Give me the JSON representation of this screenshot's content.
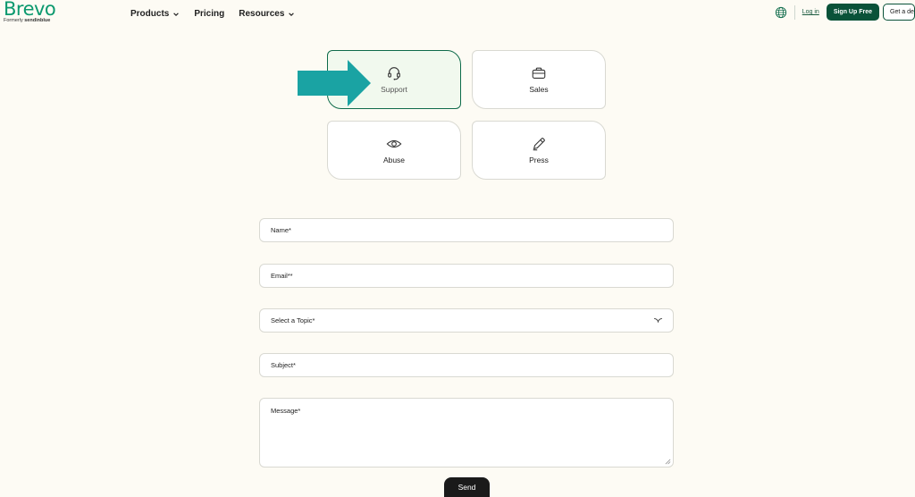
{
  "header": {
    "logo_text": "Brevo",
    "logo_sub_prefix": "Formerly",
    "logo_sub_brand": "sendinblue",
    "nav": [
      {
        "label": "Products",
        "has_dropdown": true
      },
      {
        "label": "Pricing",
        "has_dropdown": false
      },
      {
        "label": "Resources",
        "has_dropdown": true
      }
    ],
    "language_icon": "globe-icon",
    "login_label": "Log in",
    "signup_label": "Sign Up Free",
    "demo_label": "Get a demo"
  },
  "cards": [
    {
      "label": "Support",
      "icon": "headset-icon",
      "selected": true
    },
    {
      "label": "Sales",
      "icon": "briefcase-icon",
      "selected": false
    },
    {
      "label": "Abuse",
      "icon": "eye-icon",
      "selected": false
    },
    {
      "label": "Press",
      "icon": "pencil-icon",
      "selected": false
    }
  ],
  "annotation": {
    "icon": "arrow-right-icon",
    "color": "#1aa3a3"
  },
  "form": {
    "name_placeholder": "Name*",
    "email_placeholder": "Email**",
    "topic_placeholder": "Select a Topic*",
    "subject_placeholder": "Subject*",
    "message_placeholder": "Message*",
    "send_label": "Send"
  },
  "colors": {
    "brand": "#0b996e",
    "brand_dark": "#0a5239",
    "page_bg": "#fdfbf4",
    "selected_card_bg": "#f1f9ee"
  }
}
